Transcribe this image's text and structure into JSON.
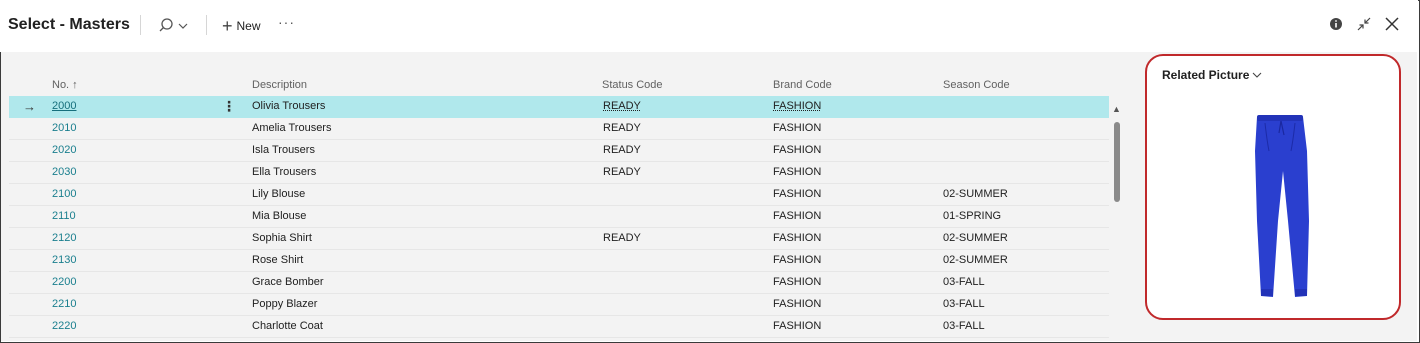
{
  "header": {
    "title": "Select - Masters",
    "new_label": "New",
    "more_label": "···",
    "icons": [
      "search-icon",
      "chevron-down-icon",
      "plus-icon",
      "more-icon",
      "info-icon",
      "collapse-icon",
      "close-icon"
    ]
  },
  "grid": {
    "columns": {
      "no": "No. ↑",
      "description": "Description",
      "status_code": "Status Code",
      "brand_code": "Brand Code",
      "season_code": "Season Code"
    },
    "rows": [
      {
        "no": "2000",
        "description": "Olivia Trousers",
        "status": "READY",
        "brand": "FASHION",
        "season": ""
      },
      {
        "no": "2010",
        "description": "Amelia Trousers",
        "status": "READY",
        "brand": "FASHION",
        "season": ""
      },
      {
        "no": "2020",
        "description": "Isla Trousers",
        "status": "READY",
        "brand": "FASHION",
        "season": ""
      },
      {
        "no": "2030",
        "description": "Ella Trousers",
        "status": "READY",
        "brand": "FASHION",
        "season": ""
      },
      {
        "no": "2100",
        "description": "Lily Blouse",
        "status": "",
        "brand": "FASHION",
        "season": "02-SUMMER"
      },
      {
        "no": "2110",
        "description": "Mia Blouse",
        "status": "",
        "brand": "FASHION",
        "season": "01-SPRING"
      },
      {
        "no": "2120",
        "description": "Sophia Shirt",
        "status": "READY",
        "brand": "FASHION",
        "season": "02-SUMMER"
      },
      {
        "no": "2130",
        "description": "Rose Shirt",
        "status": "",
        "brand": "FASHION",
        "season": "02-SUMMER"
      },
      {
        "no": "2200",
        "description": "Grace Bomber",
        "status": "",
        "brand": "FASHION",
        "season": "03-FALL"
      },
      {
        "no": "2210",
        "description": "Poppy Blazer",
        "status": "",
        "brand": "FASHION",
        "season": "03-FALL"
      },
      {
        "no": "2220",
        "description": "Charlotte Coat",
        "status": "",
        "brand": "FASHION",
        "season": "03-FALL"
      }
    ],
    "selected_row_index": 0
  },
  "factbox": {
    "title": "Related Picture",
    "picture_color": "#2a3fcf"
  },
  "colors": {
    "selected_row": "#b0e8ec",
    "link": "#1a7f8e",
    "highlight_border": "#c0292b"
  }
}
